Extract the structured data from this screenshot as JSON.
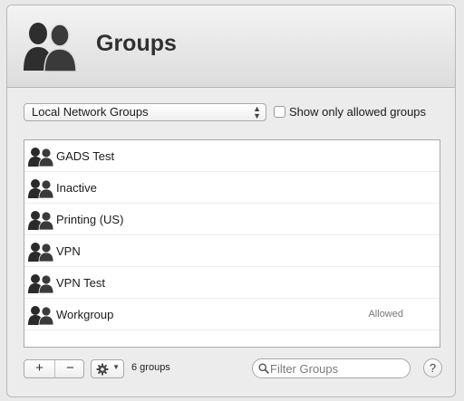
{
  "header": {
    "title": "Groups",
    "icon": "group-icon"
  },
  "source_popup": {
    "selected": "Local Network Groups",
    "arrows": "▲▼"
  },
  "filter_checkbox": {
    "label": "Show only allowed groups",
    "checked": false
  },
  "groups": [
    {
      "name": "GADS Test",
      "status": ""
    },
    {
      "name": "Inactive",
      "status": ""
    },
    {
      "name": "Printing (US)",
      "status": ""
    },
    {
      "name": "VPN",
      "status": ""
    },
    {
      "name": "VPN Test",
      "status": ""
    },
    {
      "name": "Workgroup",
      "status": "Allowed"
    }
  ],
  "footer": {
    "add_label": "+",
    "remove_label": "−",
    "count_label": "6 groups",
    "filter_placeholder": "Filter Groups",
    "help_label": "?"
  },
  "colors": {
    "icon": "#2b2b2b",
    "list_bg": "#ffffff",
    "header_top": "#f3f3f3",
    "header_bottom": "#dcdcdc"
  }
}
